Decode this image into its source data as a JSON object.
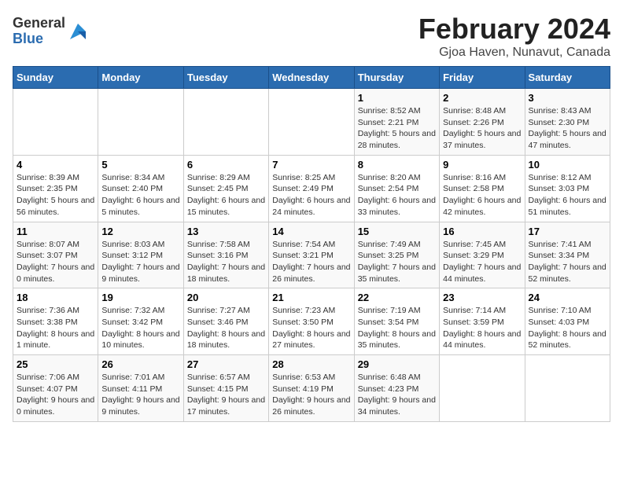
{
  "logo": {
    "general": "General",
    "blue": "Blue"
  },
  "title": "February 2024",
  "subtitle": "Gjoa Haven, Nunavut, Canada",
  "weekdays": [
    "Sunday",
    "Monday",
    "Tuesday",
    "Wednesday",
    "Thursday",
    "Friday",
    "Saturday"
  ],
  "weeks": [
    [
      {
        "day": "",
        "detail": ""
      },
      {
        "day": "",
        "detail": ""
      },
      {
        "day": "",
        "detail": ""
      },
      {
        "day": "",
        "detail": ""
      },
      {
        "day": "1",
        "detail": "Sunrise: 8:52 AM\nSunset: 2:21 PM\nDaylight: 5 hours and 28 minutes."
      },
      {
        "day": "2",
        "detail": "Sunrise: 8:48 AM\nSunset: 2:26 PM\nDaylight: 5 hours and 37 minutes."
      },
      {
        "day": "3",
        "detail": "Sunrise: 8:43 AM\nSunset: 2:30 PM\nDaylight: 5 hours and 47 minutes."
      }
    ],
    [
      {
        "day": "4",
        "detail": "Sunrise: 8:39 AM\nSunset: 2:35 PM\nDaylight: 5 hours and 56 minutes."
      },
      {
        "day": "5",
        "detail": "Sunrise: 8:34 AM\nSunset: 2:40 PM\nDaylight: 6 hours and 5 minutes."
      },
      {
        "day": "6",
        "detail": "Sunrise: 8:29 AM\nSunset: 2:45 PM\nDaylight: 6 hours and 15 minutes."
      },
      {
        "day": "7",
        "detail": "Sunrise: 8:25 AM\nSunset: 2:49 PM\nDaylight: 6 hours and 24 minutes."
      },
      {
        "day": "8",
        "detail": "Sunrise: 8:20 AM\nSunset: 2:54 PM\nDaylight: 6 hours and 33 minutes."
      },
      {
        "day": "9",
        "detail": "Sunrise: 8:16 AM\nSunset: 2:58 PM\nDaylight: 6 hours and 42 minutes."
      },
      {
        "day": "10",
        "detail": "Sunrise: 8:12 AM\nSunset: 3:03 PM\nDaylight: 6 hours and 51 minutes."
      }
    ],
    [
      {
        "day": "11",
        "detail": "Sunrise: 8:07 AM\nSunset: 3:07 PM\nDaylight: 7 hours and 0 minutes."
      },
      {
        "day": "12",
        "detail": "Sunrise: 8:03 AM\nSunset: 3:12 PM\nDaylight: 7 hours and 9 minutes."
      },
      {
        "day": "13",
        "detail": "Sunrise: 7:58 AM\nSunset: 3:16 PM\nDaylight: 7 hours and 18 minutes."
      },
      {
        "day": "14",
        "detail": "Sunrise: 7:54 AM\nSunset: 3:21 PM\nDaylight: 7 hours and 26 minutes."
      },
      {
        "day": "15",
        "detail": "Sunrise: 7:49 AM\nSunset: 3:25 PM\nDaylight: 7 hours and 35 minutes."
      },
      {
        "day": "16",
        "detail": "Sunrise: 7:45 AM\nSunset: 3:29 PM\nDaylight: 7 hours and 44 minutes."
      },
      {
        "day": "17",
        "detail": "Sunrise: 7:41 AM\nSunset: 3:34 PM\nDaylight: 7 hours and 52 minutes."
      }
    ],
    [
      {
        "day": "18",
        "detail": "Sunrise: 7:36 AM\nSunset: 3:38 PM\nDaylight: 8 hours and 1 minute."
      },
      {
        "day": "19",
        "detail": "Sunrise: 7:32 AM\nSunset: 3:42 PM\nDaylight: 8 hours and 10 minutes."
      },
      {
        "day": "20",
        "detail": "Sunrise: 7:27 AM\nSunset: 3:46 PM\nDaylight: 8 hours and 18 minutes."
      },
      {
        "day": "21",
        "detail": "Sunrise: 7:23 AM\nSunset: 3:50 PM\nDaylight: 8 hours and 27 minutes."
      },
      {
        "day": "22",
        "detail": "Sunrise: 7:19 AM\nSunset: 3:54 PM\nDaylight: 8 hours and 35 minutes."
      },
      {
        "day": "23",
        "detail": "Sunrise: 7:14 AM\nSunset: 3:59 PM\nDaylight: 8 hours and 44 minutes."
      },
      {
        "day": "24",
        "detail": "Sunrise: 7:10 AM\nSunset: 4:03 PM\nDaylight: 8 hours and 52 minutes."
      }
    ],
    [
      {
        "day": "25",
        "detail": "Sunrise: 7:06 AM\nSunset: 4:07 PM\nDaylight: 9 hours and 0 minutes."
      },
      {
        "day": "26",
        "detail": "Sunrise: 7:01 AM\nSunset: 4:11 PM\nDaylight: 9 hours and 9 minutes."
      },
      {
        "day": "27",
        "detail": "Sunrise: 6:57 AM\nSunset: 4:15 PM\nDaylight: 9 hours and 17 minutes."
      },
      {
        "day": "28",
        "detail": "Sunrise: 6:53 AM\nSunset: 4:19 PM\nDaylight: 9 hours and 26 minutes."
      },
      {
        "day": "29",
        "detail": "Sunrise: 6:48 AM\nSunset: 4:23 PM\nDaylight: 9 hours and 34 minutes."
      },
      {
        "day": "",
        "detail": ""
      },
      {
        "day": "",
        "detail": ""
      }
    ]
  ]
}
